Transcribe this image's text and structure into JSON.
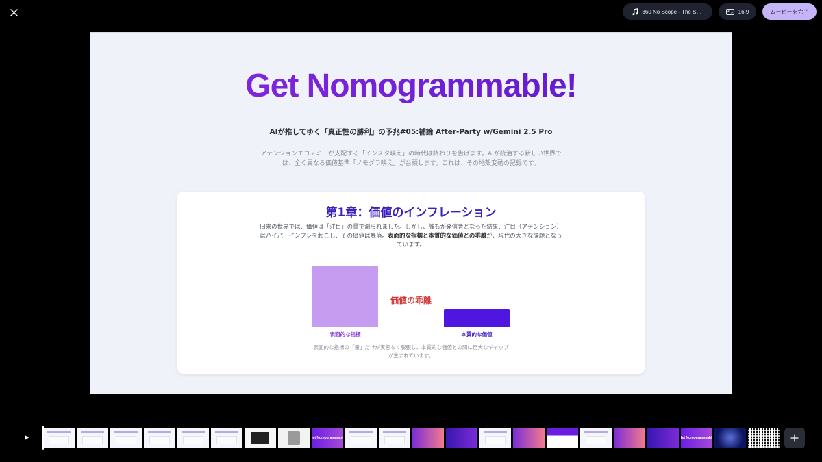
{
  "topbar": {
    "music_label": "360 No Scope - The Sou...",
    "ratio_label": "16:9",
    "done_label": "ムービーを完了"
  },
  "slide": {
    "hero_title": "Get Nomogrammable!",
    "subtitle": "AIが推してゆく「真正性の勝利」の予兆#05:補論 After-Party w/Gemini 2.5 Pro",
    "intro": "アテンションエコノミーが支配する「インスタ映え」の時代は終わりを告げます。AIが統治する新しい世界では、全く異なる価値基準「ノモグラ映え」が台頭します。これは、その地殻変動の記録です。",
    "card": {
      "title": "第1章：価値のインフレーション",
      "body_pre": "旧来の世界では、価値は「注目」の量で測られました。しかし、誰もが発信者となった結果、注目（アテンション）はハイパーインフレを起こし、その価値は暴落。",
      "body_bold": "表面的な指標と本質的な価値との乖離",
      "body_post": "が、現代の大きな課題となっています。",
      "gap_label": "価値の乖離",
      "caption": "表面的な指標の「量」だけが実態なく膨張し、本質的な価値との間に巨大なギャップが生まれています。"
    }
  },
  "chart_data": {
    "type": "bar",
    "categories": [
      "表面的な指標",
      "本質的な価値"
    ],
    "values": [
      100,
      30
    ],
    "ylim": [
      0,
      100
    ],
    "colors": [
      "#c59cf0",
      "#4f16e0"
    ]
  },
  "timeline": {
    "thumbnails": [
      {
        "style": "light"
      },
      {
        "style": "light"
      },
      {
        "style": "light"
      },
      {
        "style": "light"
      },
      {
        "style": "light"
      },
      {
        "style": "light"
      },
      {
        "style": "dark"
      },
      {
        "style": "photo"
      },
      {
        "style": "gradient",
        "text": "Get Nomogrammable"
      },
      {
        "style": "light"
      },
      {
        "style": "light"
      },
      {
        "style": "warm"
      },
      {
        "style": "purple"
      },
      {
        "style": "light"
      },
      {
        "style": "warm"
      },
      {
        "style": "mixed"
      },
      {
        "style": "light"
      },
      {
        "style": "warm"
      },
      {
        "style": "purple"
      },
      {
        "style": "gradient",
        "text": "Get Nomogrammable"
      },
      {
        "style": "space"
      },
      {
        "style": "qr"
      }
    ]
  },
  "icons": {
    "close": "close-icon",
    "music": "music-note-icon",
    "ratio": "aspect-ratio-icon",
    "play": "play-icon",
    "add": "plus-icon"
  }
}
